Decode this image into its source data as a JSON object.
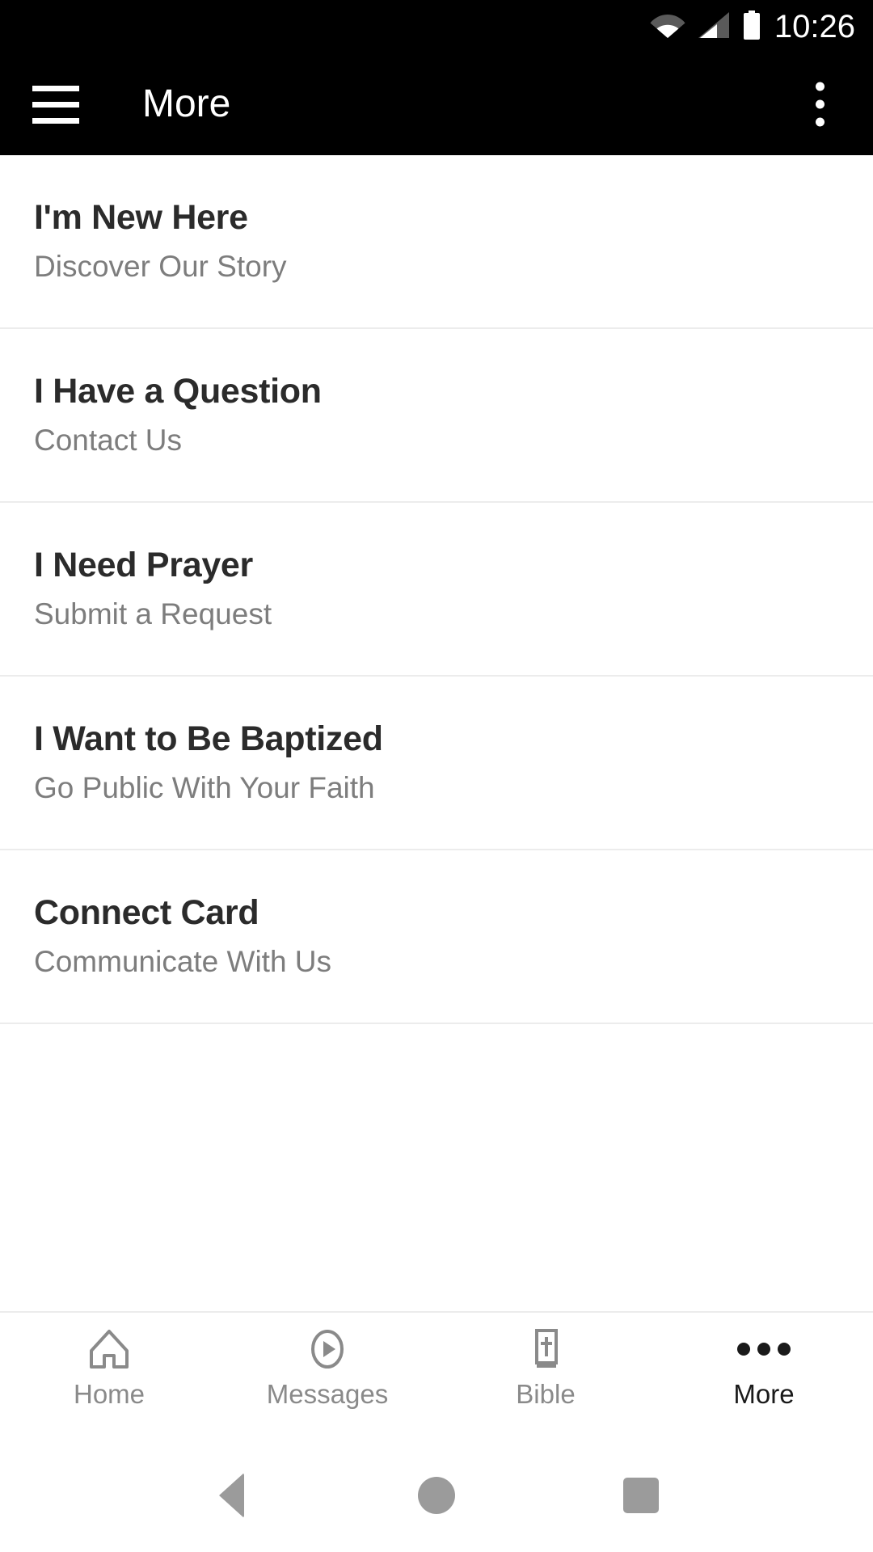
{
  "status_bar": {
    "time": "10:26",
    "icons": [
      "wifi-icon",
      "cellular-signal-icon",
      "battery-icon"
    ]
  },
  "toolbar": {
    "title": "More",
    "menu_icon": "hamburger-menu-icon",
    "overflow_icon": "overflow-menu-icon"
  },
  "list": {
    "items": [
      {
        "title": "I'm New Here",
        "subtitle": "Discover Our Story"
      },
      {
        "title": "I Have a Question",
        "subtitle": "Contact Us"
      },
      {
        "title": "I Need Prayer",
        "subtitle": "Submit a Request"
      },
      {
        "title": "I Want to Be Baptized",
        "subtitle": "Go Public With Your Faith"
      },
      {
        "title": "Connect Card",
        "subtitle": "Communicate With Us"
      }
    ]
  },
  "tabbar": {
    "tabs": [
      {
        "label": "Home",
        "icon": "house-icon",
        "active": false
      },
      {
        "label": "Messages",
        "icon": "play-circle-icon",
        "active": false
      },
      {
        "label": "Bible",
        "icon": "bible-book-icon",
        "active": false
      },
      {
        "label": "More",
        "icon": "ellipsis-icon",
        "active": true
      }
    ]
  },
  "system_nav": {
    "buttons": [
      "back-button",
      "home-button",
      "recents-button"
    ]
  },
  "colors": {
    "toolbar_background": "#000000",
    "page_background": "#ffffff",
    "title_text": "#2b2b2b",
    "subtitle_text": "#7d7d7d",
    "divider": "#ececec",
    "tab_inactive": "#8a8a8a",
    "tab_active": "#1a1a1a",
    "system_nav_icon": "#9b9b9b"
  }
}
